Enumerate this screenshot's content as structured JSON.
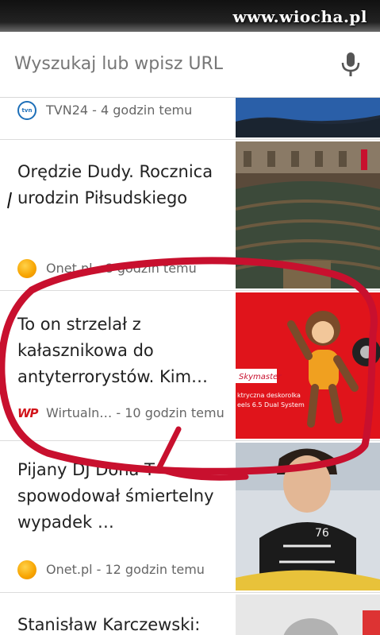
{
  "watermark": "www.wiocha.pl",
  "search": {
    "placeholder": "Wyszukaj lub wpisz URL"
  },
  "cards": [
    {
      "title": "",
      "source": "TVN24 - 4 godzin temu",
      "source_icon": "tvn24-icon"
    },
    {
      "title": "Orędzie Dudy. Rocznica urodzin Piłsudskiego",
      "source": "Onet.pl - 8 godzin temu",
      "source_icon": "onet-icon"
    },
    {
      "title": "To on strzelał z kałasznikowa do antyterrorystów. Kim…",
      "source": "Wirtualn… - 10 godzin temu",
      "source_icon": "wp-icon"
    },
    {
      "title": "Pijany DJ Dona T spowodował śmiertelny wypadek …",
      "source": "Onet.pl - 12 godzin temu",
      "source_icon": "onet-icon"
    },
    {
      "title": "Stanisław Karczewski:",
      "source": "",
      "source_icon": ""
    }
  ],
  "ad": {
    "brand": "Skymaster",
    "line1": "ktryczna deskorolka",
    "line2": "eels 6.5 Dual System"
  },
  "colors": {
    "accent_red": "#c8102e",
    "tvn_blue": "#1d6fb8",
    "onet_orange": "#f7a400"
  }
}
